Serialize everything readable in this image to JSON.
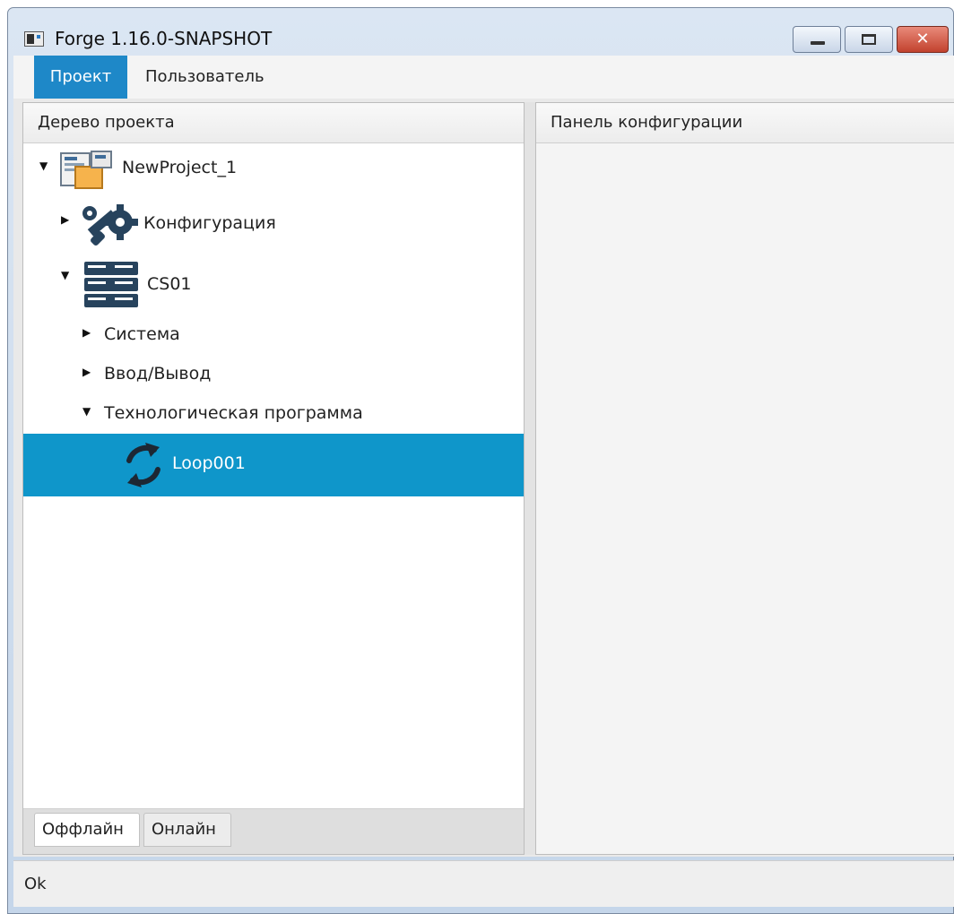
{
  "window": {
    "title": "Forge 1.16.0-SNAPSHOT"
  },
  "menu": {
    "items": [
      {
        "label": "Проект",
        "active": true
      },
      {
        "label": "Пользователь"
      }
    ]
  },
  "left_panel": {
    "header": "Дерево проекта",
    "tree": {
      "project": "NewProject_1",
      "config": "Конфигурация",
      "station": "CS01",
      "system": "Система",
      "io": "Ввод/Вывод",
      "program": "Технологическая программа",
      "loop": "Loop001"
    },
    "tabs": [
      {
        "label": "Оффлайн",
        "active": true
      },
      {
        "label": "Онлайн"
      }
    ]
  },
  "right_panel": {
    "header": "Панель конфигурации"
  },
  "status": {
    "text": "Ok"
  },
  "colors": {
    "selection": "#0f96ca",
    "menu_active": "#1e88c8",
    "icon_dark": "#27435d"
  },
  "icons": [
    "project-icon",
    "config-tools-icon",
    "server-rack-icon",
    "loop-refresh-icon"
  ]
}
